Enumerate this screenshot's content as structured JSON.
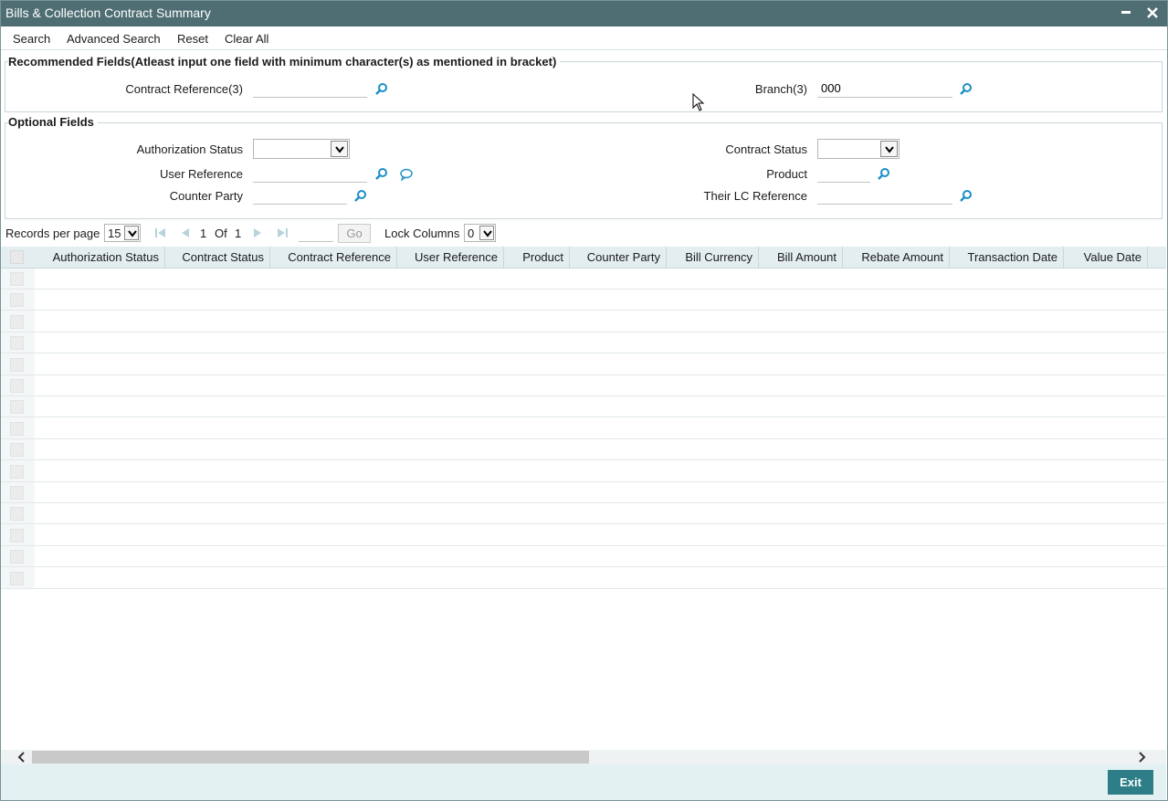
{
  "window": {
    "title": "Bills & Collection Contract Summary",
    "minimize_glyph": "▃",
    "close_glyph": "✕"
  },
  "toolbar": {
    "search": "Search",
    "advanced_search": "Advanced Search",
    "reset": "Reset",
    "clear_all": "Clear All"
  },
  "recommended": {
    "heading": "Recommended Fields(Atleast input one field with minimum character(s) as mentioned in bracket)",
    "contract_reference_label": "Contract Reference(3)",
    "contract_reference_value": "",
    "branch_label": "Branch(3)",
    "branch_value": "000"
  },
  "optional": {
    "heading": "Optional Fields",
    "authorization_status_label": "Authorization Status",
    "contract_status_label": "Contract Status",
    "user_reference_label": "User Reference",
    "product_label": "Product",
    "counter_party_label": "Counter Party",
    "their_lc_reference_label": "Their LC Reference"
  },
  "pager": {
    "records_per_page_label": "Records per page",
    "records_per_page_value": "15",
    "current_page": "1",
    "of_label": "Of",
    "total_pages": "1",
    "go_label": "Go",
    "lock_columns_label": "Lock Columns",
    "lock_columns_value": "0"
  },
  "grid": {
    "columns": [
      "Authorization Status",
      "Contract Status",
      "Contract Reference",
      "User Reference",
      "Product",
      "Counter Party",
      "Bill Currency",
      "Bill Amount",
      "Rebate Amount",
      "Transaction Date",
      "Value Date"
    ],
    "rows": 15
  },
  "footer": {
    "exit_label": "Exit"
  },
  "icons": {
    "lookup": "magnifier-icon",
    "note": "speech-bubble-icon"
  },
  "colors": {
    "titlebar": "#4f6e73",
    "accent": "#2e7e88",
    "icon_blue": "#1b8fc7"
  }
}
